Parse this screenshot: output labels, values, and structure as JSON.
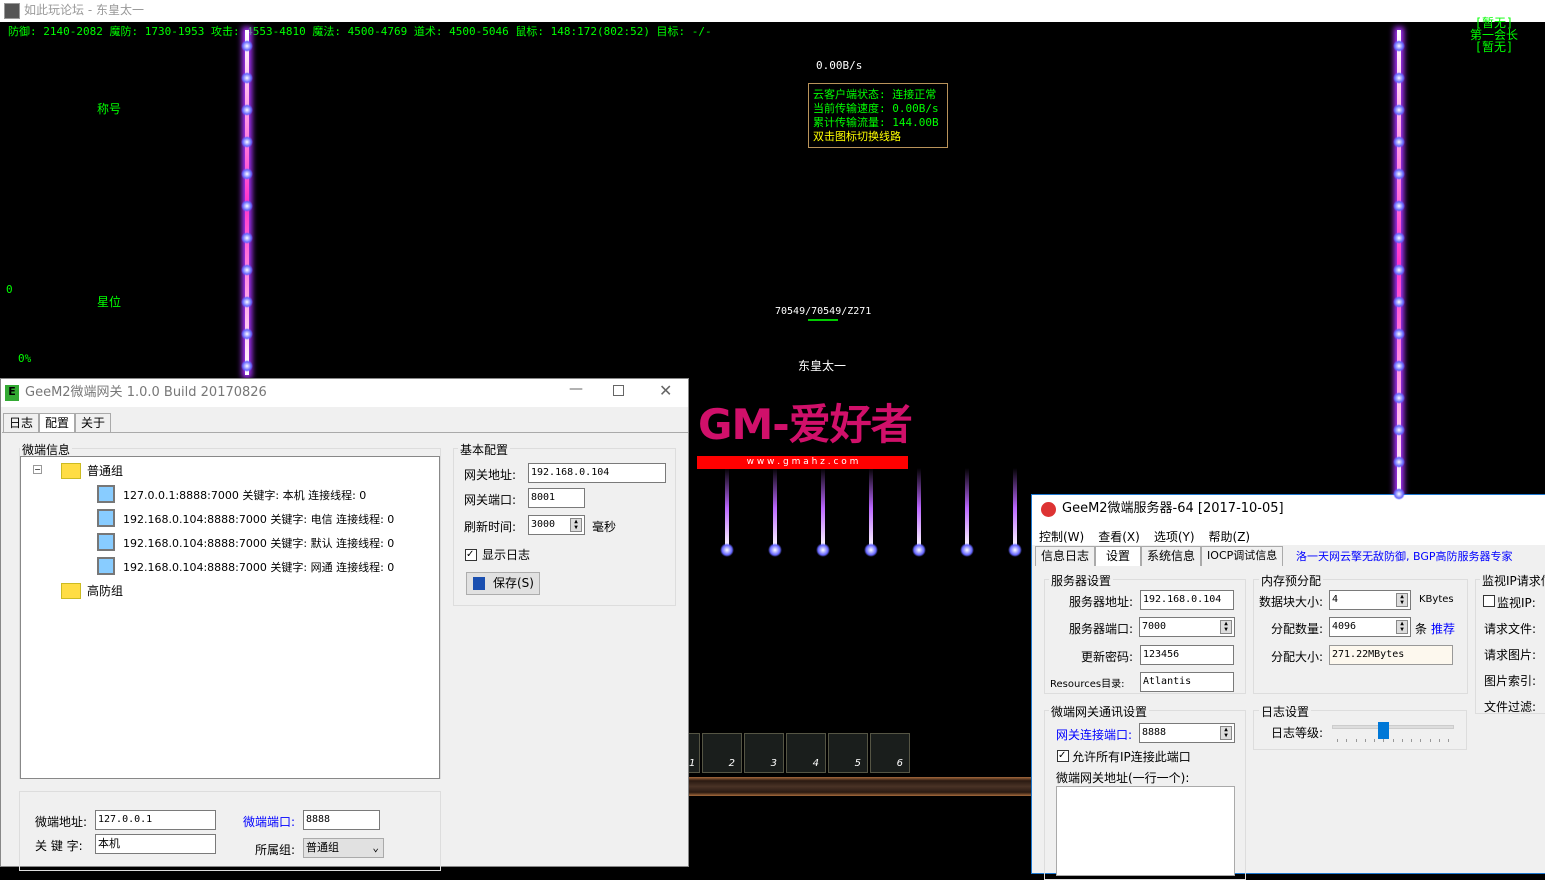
{
  "game": {
    "title": "如此玩论坛 - 东皇太一",
    "status_line": "防御: 2140-2082 魔防: 1730-1953 攻击: 4553-4810 魔法: 4500-4769 道术: 4500-5046 鼠标: 148:172(802:52) 目标: -/-",
    "title_label": "称号",
    "star_label": "星位",
    "zero": "0",
    "percent": "0%",
    "speed": "0.00B/s",
    "tooltip": {
      "l1": "云客户端状态: 连接正常",
      "l2": "当前传输速度: 0.00B/s",
      "l3": "累计传输流量: 144.00B",
      "l4": "双击图标切换线路"
    },
    "hp": "70549/70549/Z271",
    "player_name": "东皇太一",
    "guild": {
      "l1": "[暂无]",
      "l2": "第一会长",
      "l3": "[暂无]"
    },
    "slots": [
      "1",
      "2",
      "3",
      "4",
      "5",
      "6"
    ]
  },
  "logo": {
    "text": "GM-爱好者",
    "url": "w w w . g m a h z . c o m"
  },
  "gateway": {
    "title": "GeeM2微端网关 1.0.0 Build 20170826",
    "tabs": [
      "日志",
      "配置",
      "关于"
    ],
    "info_group": "微端信息",
    "tree": {
      "group1": "普通组",
      "items": [
        "127.0.0.1:8888:7000 关键字: 本机 连接线程: 0",
        "192.168.0.104:8888:7000 关键字: 电信 连接线程: 0",
        "192.168.0.104:8888:7000 关键字: 默认 连接线程: 0",
        "192.168.0.104:8888:7000 关键字: 网通 连接线程: 0"
      ],
      "group2": "高防组"
    },
    "basic": {
      "group": "基本配置",
      "addr_label": "网关地址:",
      "addr": "192.168.0.104",
      "port_label": "网关端口:",
      "port": "8001",
      "refresh_label": "刷新时间:",
      "refresh": "3000",
      "ms": "毫秒",
      "show_log": "显示日志",
      "save": "保存(S)"
    },
    "edit": {
      "addr_label": "微端地址:",
      "addr": "127.0.0.1",
      "key_label": "关 键 字:",
      "key": "本机",
      "port_label": "微端端口:",
      "port": "8888",
      "group_label": "所属组:",
      "group": "普通组"
    }
  },
  "server": {
    "title": "GeeM2微端服务器-64 [2017-10-05]",
    "menu": [
      "控制(W)",
      "查看(X)",
      "选项(Y)",
      "帮助(Z)"
    ],
    "tabs": [
      "信息日志",
      "设置",
      "系统信息",
      "IOCP调试信息"
    ],
    "ad": "洛一天网云擎无敌防御, BGP高防服务器专家",
    "srv": {
      "group": "服务器设置",
      "addr_label": "服务器地址:",
      "addr": "192.168.0.104",
      "port_label": "服务器端口:",
      "port": "7000",
      "pwd_label": "更新密码:",
      "pwd": "123456",
      "res_label": "Resources目录:",
      "res": "Atlantis"
    },
    "mem": {
      "group": "内存预分配",
      "block_label": "数据块大小:",
      "block": "4",
      "block_unit": "KBytes",
      "count_label": "分配数量:",
      "count": "4096",
      "count_unit": "条",
      "recommend": "推荐",
      "size_label": "分配大小:",
      "size": "271.22MBytes"
    },
    "monitor": {
      "group": "监视IP请求信",
      "ip": "监视IP:",
      "file": "请求文件:",
      "image": "请求图片:",
      "index": "图片索引:",
      "filter": "文件过滤:"
    },
    "gw": {
      "group": "微端网关通讯设置",
      "port_label": "网关连接端口:",
      "port": "8888",
      "allow": "允许所有IP连接此端口",
      "addr_label": "微端网关地址(一行一个):"
    },
    "log": {
      "group": "日志设置",
      "level_label": "日志等级:",
      "level": 5,
      "level_max": 13
    }
  }
}
